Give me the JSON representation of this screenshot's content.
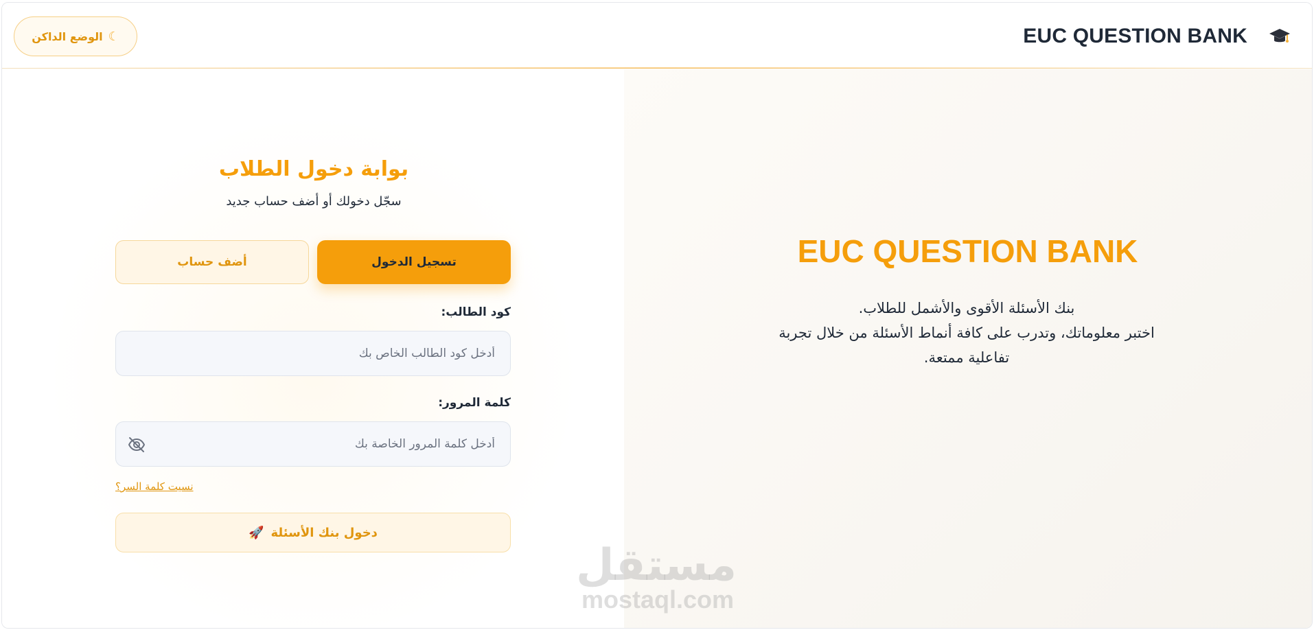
{
  "header": {
    "brand_title": "EUC QUESTION BANK",
    "brand_icon": "graduation-cap-icon",
    "dark_mode_label": "الوضع الداكن",
    "dark_mode_icon": "moon-icon"
  },
  "hero": {
    "title": "EUC QUESTION BANK",
    "lines": [
      "بنك الأسئلة الأقوى والأشمل للطلاب.",
      "اختبر معلوماتك، وتدرب على كافة أنماط الأسئلة من خلال تجربة",
      "تفاعلية ممتعة."
    ]
  },
  "login": {
    "title": "بوابة دخول الطلاب",
    "subtitle": "سجّل دخولك أو أضف حساب جديد",
    "tabs": {
      "login": "تسجيل الدخول",
      "add_account": "أضف حساب"
    },
    "student_code_label": "كود الطالب:",
    "student_code_placeholder": "أدخل كود الطالب الخاص بك",
    "password_label": "كلمة المرور:",
    "password_placeholder": "أدخل كلمة المرور الخاصة بك",
    "forgot_password": "نسيت كلمة السر؟",
    "submit_label": "دخول بنك الأسئلة",
    "submit_icon": "rocket-icon"
  },
  "watermark": {
    "arabic": "مستقل",
    "latin": "mostaql.com"
  },
  "colors": {
    "accent": "#f59e0b",
    "accent_text": "#e0950e",
    "text": "#1f2937"
  }
}
